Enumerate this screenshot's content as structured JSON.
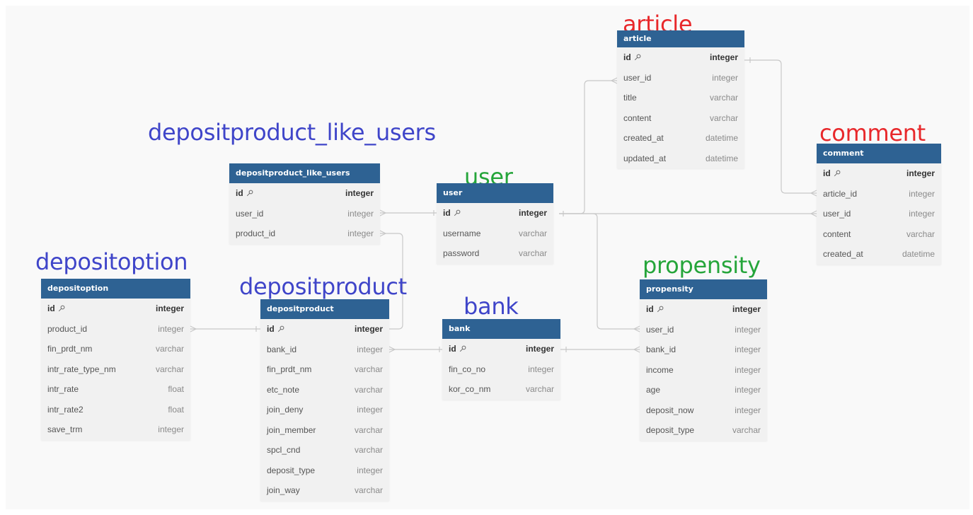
{
  "colors": {
    "blue": "#3f45c9",
    "red": "#e8282b",
    "green": "#25a53a",
    "table_header": "#2e6293",
    "row_bg": "#f1f1f1",
    "line": "#c8c8c8"
  },
  "captions": {
    "article": {
      "text": "article",
      "color": "red"
    },
    "comment": {
      "text": "comment",
      "color": "red"
    },
    "user": {
      "text": "user",
      "color": "green"
    },
    "propensity": {
      "text": "propensity",
      "color": "green"
    },
    "like_users": {
      "text": "depositproduct_like_users",
      "color": "blue"
    },
    "depositoption": {
      "text": "depositoption",
      "color": "blue"
    },
    "depositproduct": {
      "text": "depositproduct",
      "color": "blue"
    },
    "bank": {
      "text": "bank",
      "color": "blue"
    }
  },
  "tables": {
    "article": {
      "name": "article",
      "fields": [
        {
          "name": "id",
          "type": "integer",
          "pk": true
        },
        {
          "name": "user_id",
          "type": "integer"
        },
        {
          "name": "title",
          "type": "varchar"
        },
        {
          "name": "content",
          "type": "varchar"
        },
        {
          "name": "created_at",
          "type": "datetime"
        },
        {
          "name": "updated_at",
          "type": "datetime"
        }
      ]
    },
    "comment": {
      "name": "comment",
      "fields": [
        {
          "name": "id",
          "type": "integer",
          "pk": true
        },
        {
          "name": "article_id",
          "type": "integer"
        },
        {
          "name": "user_id",
          "type": "integer"
        },
        {
          "name": "content",
          "type": "varchar"
        },
        {
          "name": "created_at",
          "type": "datetime"
        }
      ]
    },
    "like_users": {
      "name": "depositproduct_like_users",
      "fields": [
        {
          "name": "id",
          "type": "integer",
          "pk": true
        },
        {
          "name": "user_id",
          "type": "integer"
        },
        {
          "name": "product_id",
          "type": "integer"
        }
      ]
    },
    "user": {
      "name": "user",
      "fields": [
        {
          "name": "id",
          "type": "integer",
          "pk": true
        },
        {
          "name": "username",
          "type": "varchar"
        },
        {
          "name": "password",
          "type": "varchar"
        }
      ]
    },
    "depositoption": {
      "name": "depositoption",
      "fields": [
        {
          "name": "id",
          "type": "integer",
          "pk": true
        },
        {
          "name": "product_id",
          "type": "integer"
        },
        {
          "name": "fin_prdt_nm",
          "type": "varchar"
        },
        {
          "name": "intr_rate_type_nm",
          "type": "varchar"
        },
        {
          "name": "intr_rate",
          "type": "float"
        },
        {
          "name": "intr_rate2",
          "type": "float"
        },
        {
          "name": "save_trm",
          "type": "integer"
        }
      ]
    },
    "depositproduct": {
      "name": "depositproduct",
      "fields": [
        {
          "name": "id",
          "type": "integer",
          "pk": true
        },
        {
          "name": "bank_id",
          "type": "integer"
        },
        {
          "name": "fin_prdt_nm",
          "type": "varchar"
        },
        {
          "name": "etc_note",
          "type": "varchar"
        },
        {
          "name": "join_deny",
          "type": "integer"
        },
        {
          "name": "join_member",
          "type": "varchar"
        },
        {
          "name": "spcl_cnd",
          "type": "varchar"
        },
        {
          "name": "deposit_type",
          "type": "integer"
        },
        {
          "name": "join_way",
          "type": "varchar"
        }
      ]
    },
    "bank": {
      "name": "bank",
      "fields": [
        {
          "name": "id",
          "type": "integer",
          "pk": true
        },
        {
          "name": "fin_co_no",
          "type": "integer"
        },
        {
          "name": "kor_co_nm",
          "type": "varchar"
        }
      ]
    },
    "propensity": {
      "name": "propensity",
      "fields": [
        {
          "name": "id",
          "type": "integer",
          "pk": true
        },
        {
          "name": "user_id",
          "type": "integer"
        },
        {
          "name": "bank_id",
          "type": "integer"
        },
        {
          "name": "income",
          "type": "integer"
        },
        {
          "name": "age",
          "type": "integer"
        },
        {
          "name": "deposit_now",
          "type": "integer"
        },
        {
          "name": "deposit_type",
          "type": "varchar"
        }
      ]
    }
  },
  "relations": [
    {
      "from": "article.user_id",
      "to": "user.id"
    },
    {
      "from": "comment.article_id",
      "to": "article.id"
    },
    {
      "from": "comment.user_id",
      "to": "user.id"
    },
    {
      "from": "depositproduct_like_users.user_id",
      "to": "user.id"
    },
    {
      "from": "depositproduct_like_users.product_id",
      "to": "depositproduct.id"
    },
    {
      "from": "propensity.user_id",
      "to": "user.id"
    },
    {
      "from": "depositoption.product_id",
      "to": "depositproduct.id"
    },
    {
      "from": "depositproduct.bank_id",
      "to": "bank.id"
    },
    {
      "from": "propensity.bank_id",
      "to": "bank.id"
    }
  ]
}
